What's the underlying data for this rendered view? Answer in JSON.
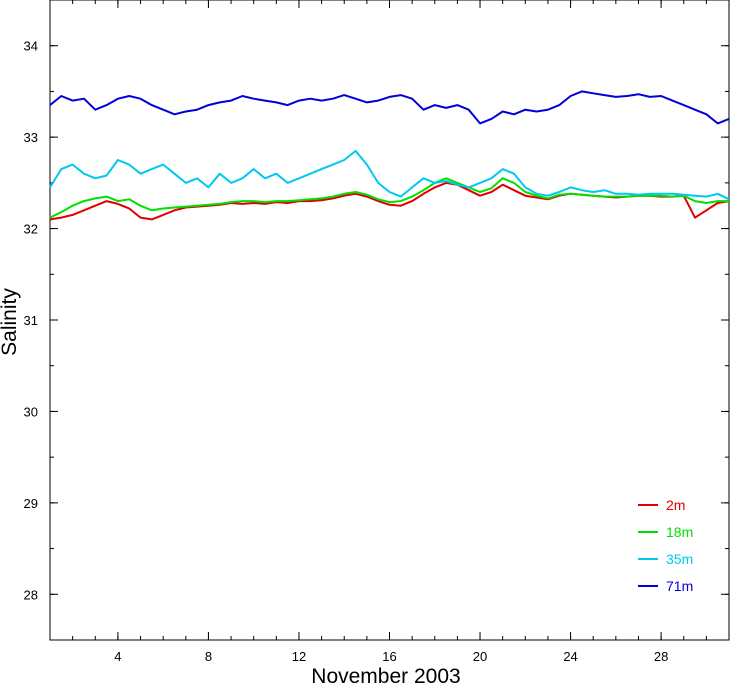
{
  "chart_data": {
    "type": "line",
    "title": "",
    "xlabel": "November 2003",
    "ylabel": "Salinity",
    "xlim": [
      1,
      31
    ],
    "ylim": [
      27.5,
      34.5
    ],
    "x_major_ticks": [
      4,
      8,
      12,
      16,
      20,
      24,
      28
    ],
    "x_tick_labels": [
      "4",
      "8",
      "12",
      "16",
      "20",
      "24",
      "28"
    ],
    "y_ticks": [
      28,
      29,
      30,
      31,
      32,
      33,
      34
    ],
    "y_tick_labels": [
      "28",
      "29",
      "30",
      "31",
      "32",
      "33",
      "34"
    ],
    "grid": false,
    "legend_position": "bottom-right",
    "x": [
      1,
      1.5,
      2,
      2.5,
      3,
      3.5,
      4,
      4.5,
      5,
      5.5,
      6,
      6.5,
      7,
      7.5,
      8,
      8.5,
      9,
      9.5,
      10,
      10.5,
      11,
      11.5,
      12,
      12.5,
      13,
      13.5,
      14,
      14.5,
      15,
      15.5,
      16,
      16.5,
      17,
      17.5,
      18,
      18.5,
      19,
      19.5,
      20,
      20.5,
      21,
      21.5,
      22,
      22.5,
      23,
      23.5,
      24,
      24.5,
      25,
      25.5,
      26,
      26.5,
      27,
      27.5,
      28,
      28.5,
      29,
      29.5,
      30,
      30.5,
      31
    ],
    "series": [
      {
        "name": "2m",
        "color": "#e00000",
        "values": [
          32.1,
          32.12,
          32.15,
          32.2,
          32.25,
          32.3,
          32.27,
          32.22,
          32.12,
          32.1,
          32.15,
          32.2,
          32.23,
          32.24,
          32.25,
          32.26,
          32.28,
          32.27,
          32.28,
          32.27,
          32.29,
          32.28,
          32.3,
          32.3,
          32.31,
          32.33,
          32.36,
          32.38,
          32.35,
          32.3,
          32.26,
          32.25,
          32.3,
          32.38,
          32.45,
          32.5,
          32.48,
          32.42,
          32.36,
          32.4,
          32.48,
          32.42,
          32.36,
          32.34,
          32.32,
          32.36,
          32.38,
          32.37,
          32.36,
          32.35,
          32.34,
          32.35,
          32.36,
          32.36,
          32.35,
          32.35,
          32.36,
          32.12,
          32.2,
          32.28,
          32.3
        ]
      },
      {
        "name": "18m",
        "color": "#00e000",
        "values": [
          32.12,
          32.18,
          32.25,
          32.3,
          32.33,
          32.35,
          32.3,
          32.32,
          32.25,
          32.2,
          32.22,
          32.23,
          32.24,
          32.25,
          32.26,
          32.27,
          32.29,
          32.3,
          32.3,
          32.29,
          32.3,
          32.3,
          32.31,
          32.32,
          32.33,
          32.35,
          32.38,
          32.4,
          32.37,
          32.32,
          32.29,
          32.3,
          32.35,
          32.42,
          32.5,
          32.55,
          32.5,
          32.45,
          32.4,
          32.44,
          32.55,
          32.5,
          32.4,
          32.36,
          32.33,
          32.37,
          32.38,
          32.37,
          32.36,
          32.35,
          32.35,
          32.35,
          32.36,
          32.36,
          32.36,
          32.35,
          32.36,
          32.3,
          32.28,
          32.3,
          32.3
        ]
      },
      {
        "name": "35m",
        "color": "#00c8f0",
        "values": [
          32.45,
          32.65,
          32.7,
          32.6,
          32.55,
          32.58,
          32.75,
          32.7,
          32.6,
          32.65,
          32.7,
          32.6,
          32.5,
          32.55,
          32.45,
          32.6,
          32.5,
          32.55,
          32.65,
          32.55,
          32.6,
          32.5,
          32.55,
          32.6,
          32.65,
          32.7,
          32.75,
          32.85,
          32.7,
          32.5,
          32.4,
          32.35,
          32.45,
          32.55,
          32.5,
          32.52,
          32.48,
          32.45,
          32.5,
          32.55,
          32.65,
          32.6,
          32.45,
          32.38,
          32.36,
          32.4,
          32.45,
          32.42,
          32.4,
          32.42,
          32.38,
          32.38,
          32.37,
          32.38,
          32.38,
          32.38,
          32.37,
          32.36,
          32.35,
          32.38,
          32.32
        ]
      },
      {
        "name": "71m",
        "color": "#0000d8",
        "values": [
          33.35,
          33.45,
          33.4,
          33.42,
          33.3,
          33.35,
          33.42,
          33.45,
          33.42,
          33.35,
          33.3,
          33.25,
          33.28,
          33.3,
          33.35,
          33.38,
          33.4,
          33.45,
          33.42,
          33.4,
          33.38,
          33.35,
          33.4,
          33.42,
          33.4,
          33.42,
          33.46,
          33.42,
          33.38,
          33.4,
          33.44,
          33.46,
          33.42,
          33.3,
          33.35,
          33.32,
          33.35,
          33.3,
          33.15,
          33.2,
          33.28,
          33.25,
          33.3,
          33.28,
          33.3,
          33.35,
          33.45,
          33.5,
          33.48,
          33.46,
          33.44,
          33.45,
          33.47,
          33.44,
          33.45,
          33.4,
          33.35,
          33.3,
          33.25,
          33.15,
          33.2
        ]
      }
    ]
  }
}
